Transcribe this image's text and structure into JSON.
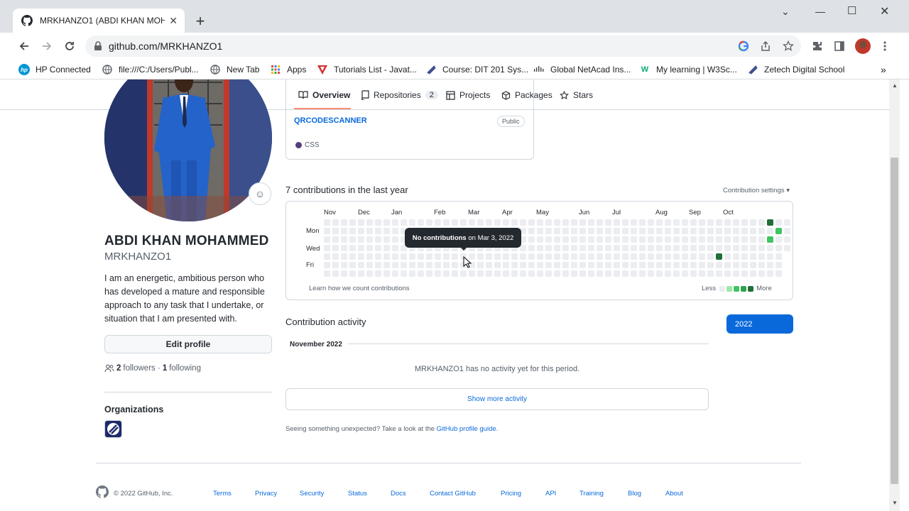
{
  "browser": {
    "tab_title": "MRKHANZO1 (ABDI KHAN MOH",
    "url": "github.com/MRKHANZO1",
    "bookmarks": [
      {
        "label": "HP Connected",
        "icon": "hp-icon"
      },
      {
        "label": "file:///C:/Users/Publ...",
        "icon": "globe-icon"
      },
      {
        "label": "New Tab",
        "icon": "globe-icon"
      },
      {
        "label": "Apps",
        "icon": "apps-grid-icon"
      },
      {
        "label": "Tutorials List - Javat...",
        "icon": "javatpoint-icon"
      },
      {
        "label": "Course: DIT 201 Sys...",
        "icon": "moodle-icon"
      },
      {
        "label": "Global NetAcad Ins...",
        "icon": "cisco-icon"
      },
      {
        "label": "My learning | W3Sc...",
        "icon": "w3schools-icon"
      },
      {
        "label": "Zetech Digital School",
        "icon": "moodle-icon"
      }
    ]
  },
  "profile": {
    "full_name": "ABDI KHAN MOHAMMED",
    "username": "MRKHANZO1",
    "bio": "I am an energetic, ambitious person who has developed a mature and responsible approach to any task that I undertake, or situation that I am presented with.",
    "edit_label": "Edit profile",
    "followers_count": "2",
    "followers_label": "followers ·",
    "following_count": "1",
    "following_label": "following",
    "organizations_title": "Organizations"
  },
  "nav": {
    "tabs": [
      {
        "label": "Overview",
        "icon": "book-icon",
        "active": true
      },
      {
        "label": "Repositories",
        "icon": "repo-icon",
        "count": "2"
      },
      {
        "label": "Projects",
        "icon": "table-icon"
      },
      {
        "label": "Packages",
        "icon": "package-icon"
      },
      {
        "label": "Stars",
        "icon": "star-icon"
      }
    ]
  },
  "repo": {
    "name": "QRCODESCANNER",
    "visibility": "Public",
    "language": "CSS",
    "language_color": "#563d7c"
  },
  "contributions": {
    "title": "7 contributions in the last year",
    "settings_label": "Contribution settings ▾",
    "months": [
      "Nov",
      "Dec",
      "Jan",
      "Feb",
      "Mar",
      "Apr",
      "May",
      "Jun",
      "Jul",
      "Aug",
      "Sep",
      "Oct"
    ],
    "day_labels": [
      "Mon",
      "Wed",
      "Fri"
    ],
    "tooltip_bold": "No contributions",
    "tooltip_rest": " on Mar 3, 2022",
    "learn_label": "Learn how we count contributions",
    "legend_less": "Less",
    "legend_more": "More",
    "level_colors": [
      "#ebedf0",
      "#9be9a8",
      "#40c463",
      "#30a14e",
      "#216e39"
    ],
    "active_cells": [
      {
        "week": 52,
        "day": 0,
        "level": 4
      },
      {
        "week": 53,
        "day": 1,
        "level": 2
      },
      {
        "week": 52,
        "day": 2,
        "level": 2
      },
      {
        "week": 46,
        "day": 4,
        "level": 4
      }
    ]
  },
  "activity": {
    "title": "Contribution activity",
    "year": "2022",
    "month_label": "November 2022",
    "no_activity": "MRKHANZO1 has no activity yet for this period.",
    "show_more": "Show more activity",
    "unexpected_text": "Seeing something unexpected? Take a look at the ",
    "unexpected_link": "GitHub profile guide",
    "unexpected_end": "."
  },
  "footer": {
    "copyright": "© 2022 GitHub, Inc.",
    "links": [
      "Terms",
      "Privacy",
      "Security",
      "Status",
      "Docs",
      "Contact GitHub",
      "Pricing",
      "API",
      "Training",
      "Blog",
      "About"
    ]
  }
}
